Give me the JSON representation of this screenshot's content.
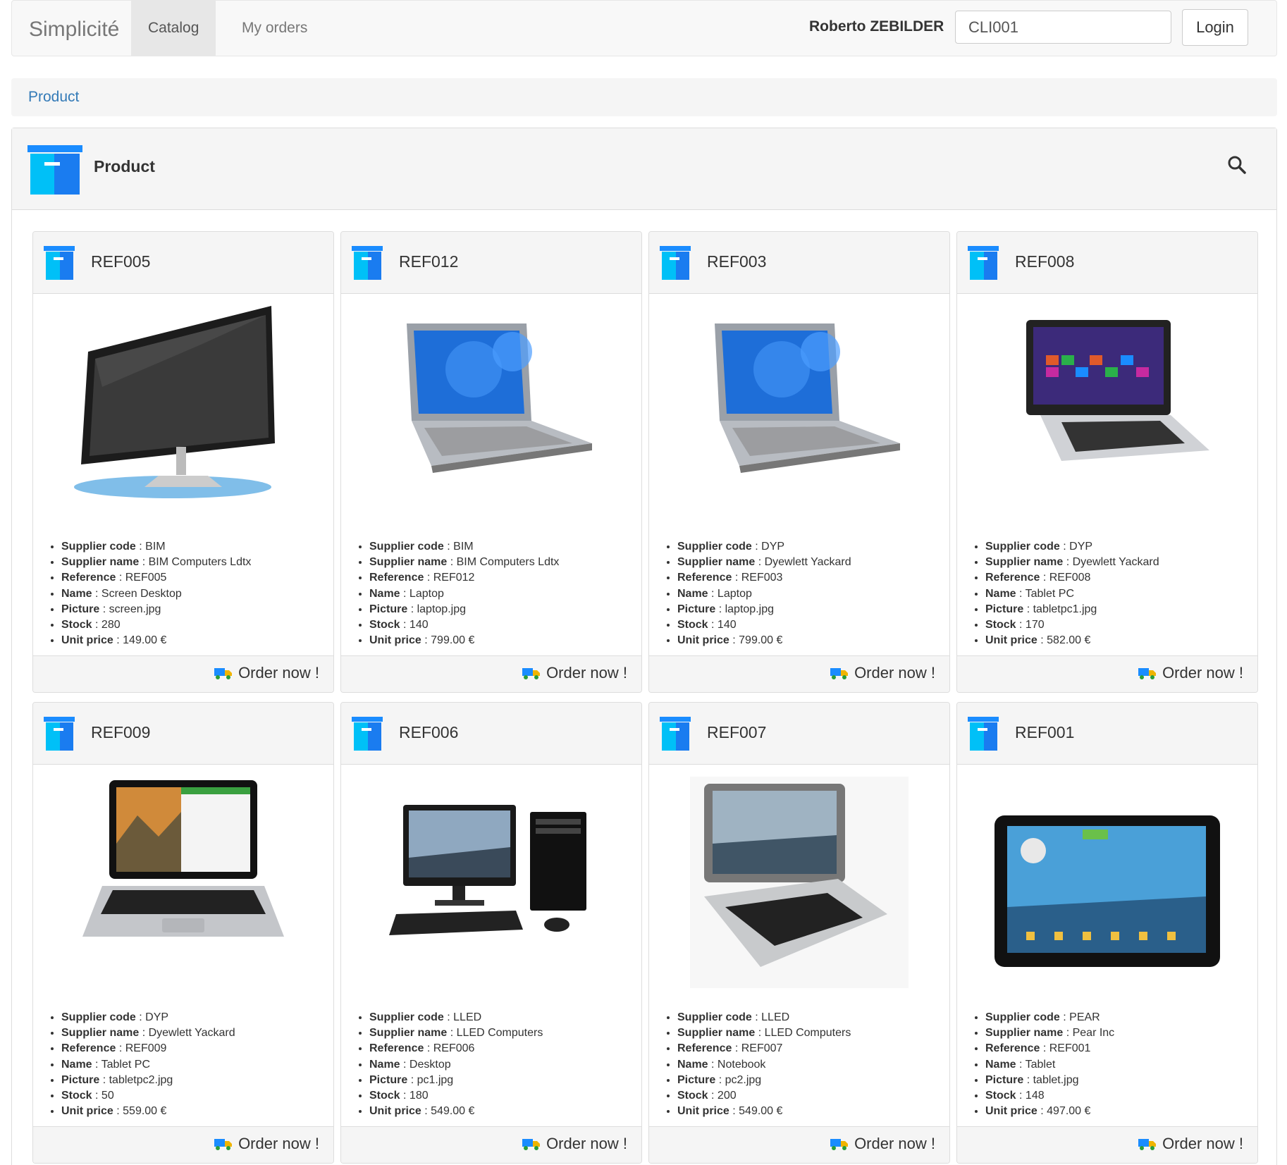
{
  "navbar": {
    "brand": "Simplicité",
    "tabs": [
      "Catalog",
      "My orders"
    ],
    "user": "Roberto ZEBILDER",
    "client_code": "CLI001",
    "login_label": "Login"
  },
  "breadcrumb": "Product",
  "panel": {
    "title": "Product"
  },
  "labels": {
    "supplier_code": "Supplier code",
    "supplier_name": "Supplier name",
    "reference": "Reference",
    "name": "Name",
    "picture": "Picture",
    "stock": "Stock",
    "unit_price": "Unit price",
    "separator": " : ",
    "order": "Order now !"
  },
  "icons": {
    "brand_icon": "product-box-icon",
    "search": "search-icon",
    "order": "truck-icon"
  },
  "colors": {
    "icon_blue": "#1a8cff",
    "icon_cyan": "#00c0f7",
    "link": "#337ab7"
  },
  "products": [
    {
      "ref": "REF005",
      "supplier_code": "BIM",
      "supplier_name": "BIM Computers Ldtx",
      "reference": "REF005",
      "name": "Screen Desktop",
      "picture": "screen.jpg",
      "stock": "280",
      "price": "149.00 €",
      "image": "monitor"
    },
    {
      "ref": "REF012",
      "supplier_code": "BIM",
      "supplier_name": "BIM Computers Ldtx",
      "reference": "REF012",
      "name": "Laptop",
      "picture": "laptop.jpg",
      "stock": "140",
      "price": "799.00 €",
      "image": "laptop"
    },
    {
      "ref": "REF003",
      "supplier_code": "DYP",
      "supplier_name": "Dyewlett Yackard",
      "reference": "REF003",
      "name": "Laptop",
      "picture": "laptop.jpg",
      "stock": "140",
      "price": "799.00 €",
      "image": "laptop"
    },
    {
      "ref": "REF008",
      "supplier_code": "DYP",
      "supplier_name": "Dyewlett Yackard",
      "reference": "REF008",
      "name": "Tablet PC",
      "picture": "tabletpc1.jpg",
      "stock": "170",
      "price": "582.00 €",
      "image": "convertible"
    },
    {
      "ref": "REF009",
      "supplier_code": "DYP",
      "supplier_name": "Dyewlett Yackard",
      "reference": "REF009",
      "name": "Tablet PC",
      "picture": "tabletpc2.jpg",
      "stock": "50",
      "price": "559.00 €",
      "image": "detachable"
    },
    {
      "ref": "REF006",
      "supplier_code": "LLED",
      "supplier_name": "LLED Computers",
      "reference": "REF006",
      "name": "Desktop",
      "picture": "pc1.jpg",
      "stock": "180",
      "price": "549.00 €",
      "image": "desktop"
    },
    {
      "ref": "REF007",
      "supplier_code": "LLED",
      "supplier_name": "LLED Computers",
      "reference": "REF007",
      "name": "Notebook",
      "picture": "pc2.jpg",
      "stock": "200",
      "price": "549.00 €",
      "image": "swivel"
    },
    {
      "ref": "REF001",
      "supplier_code": "PEAR",
      "supplier_name": "Pear Inc",
      "reference": "REF001",
      "name": "Tablet",
      "picture": "tablet.jpg",
      "stock": "148",
      "price": "497.00 €",
      "image": "tablet"
    }
  ]
}
